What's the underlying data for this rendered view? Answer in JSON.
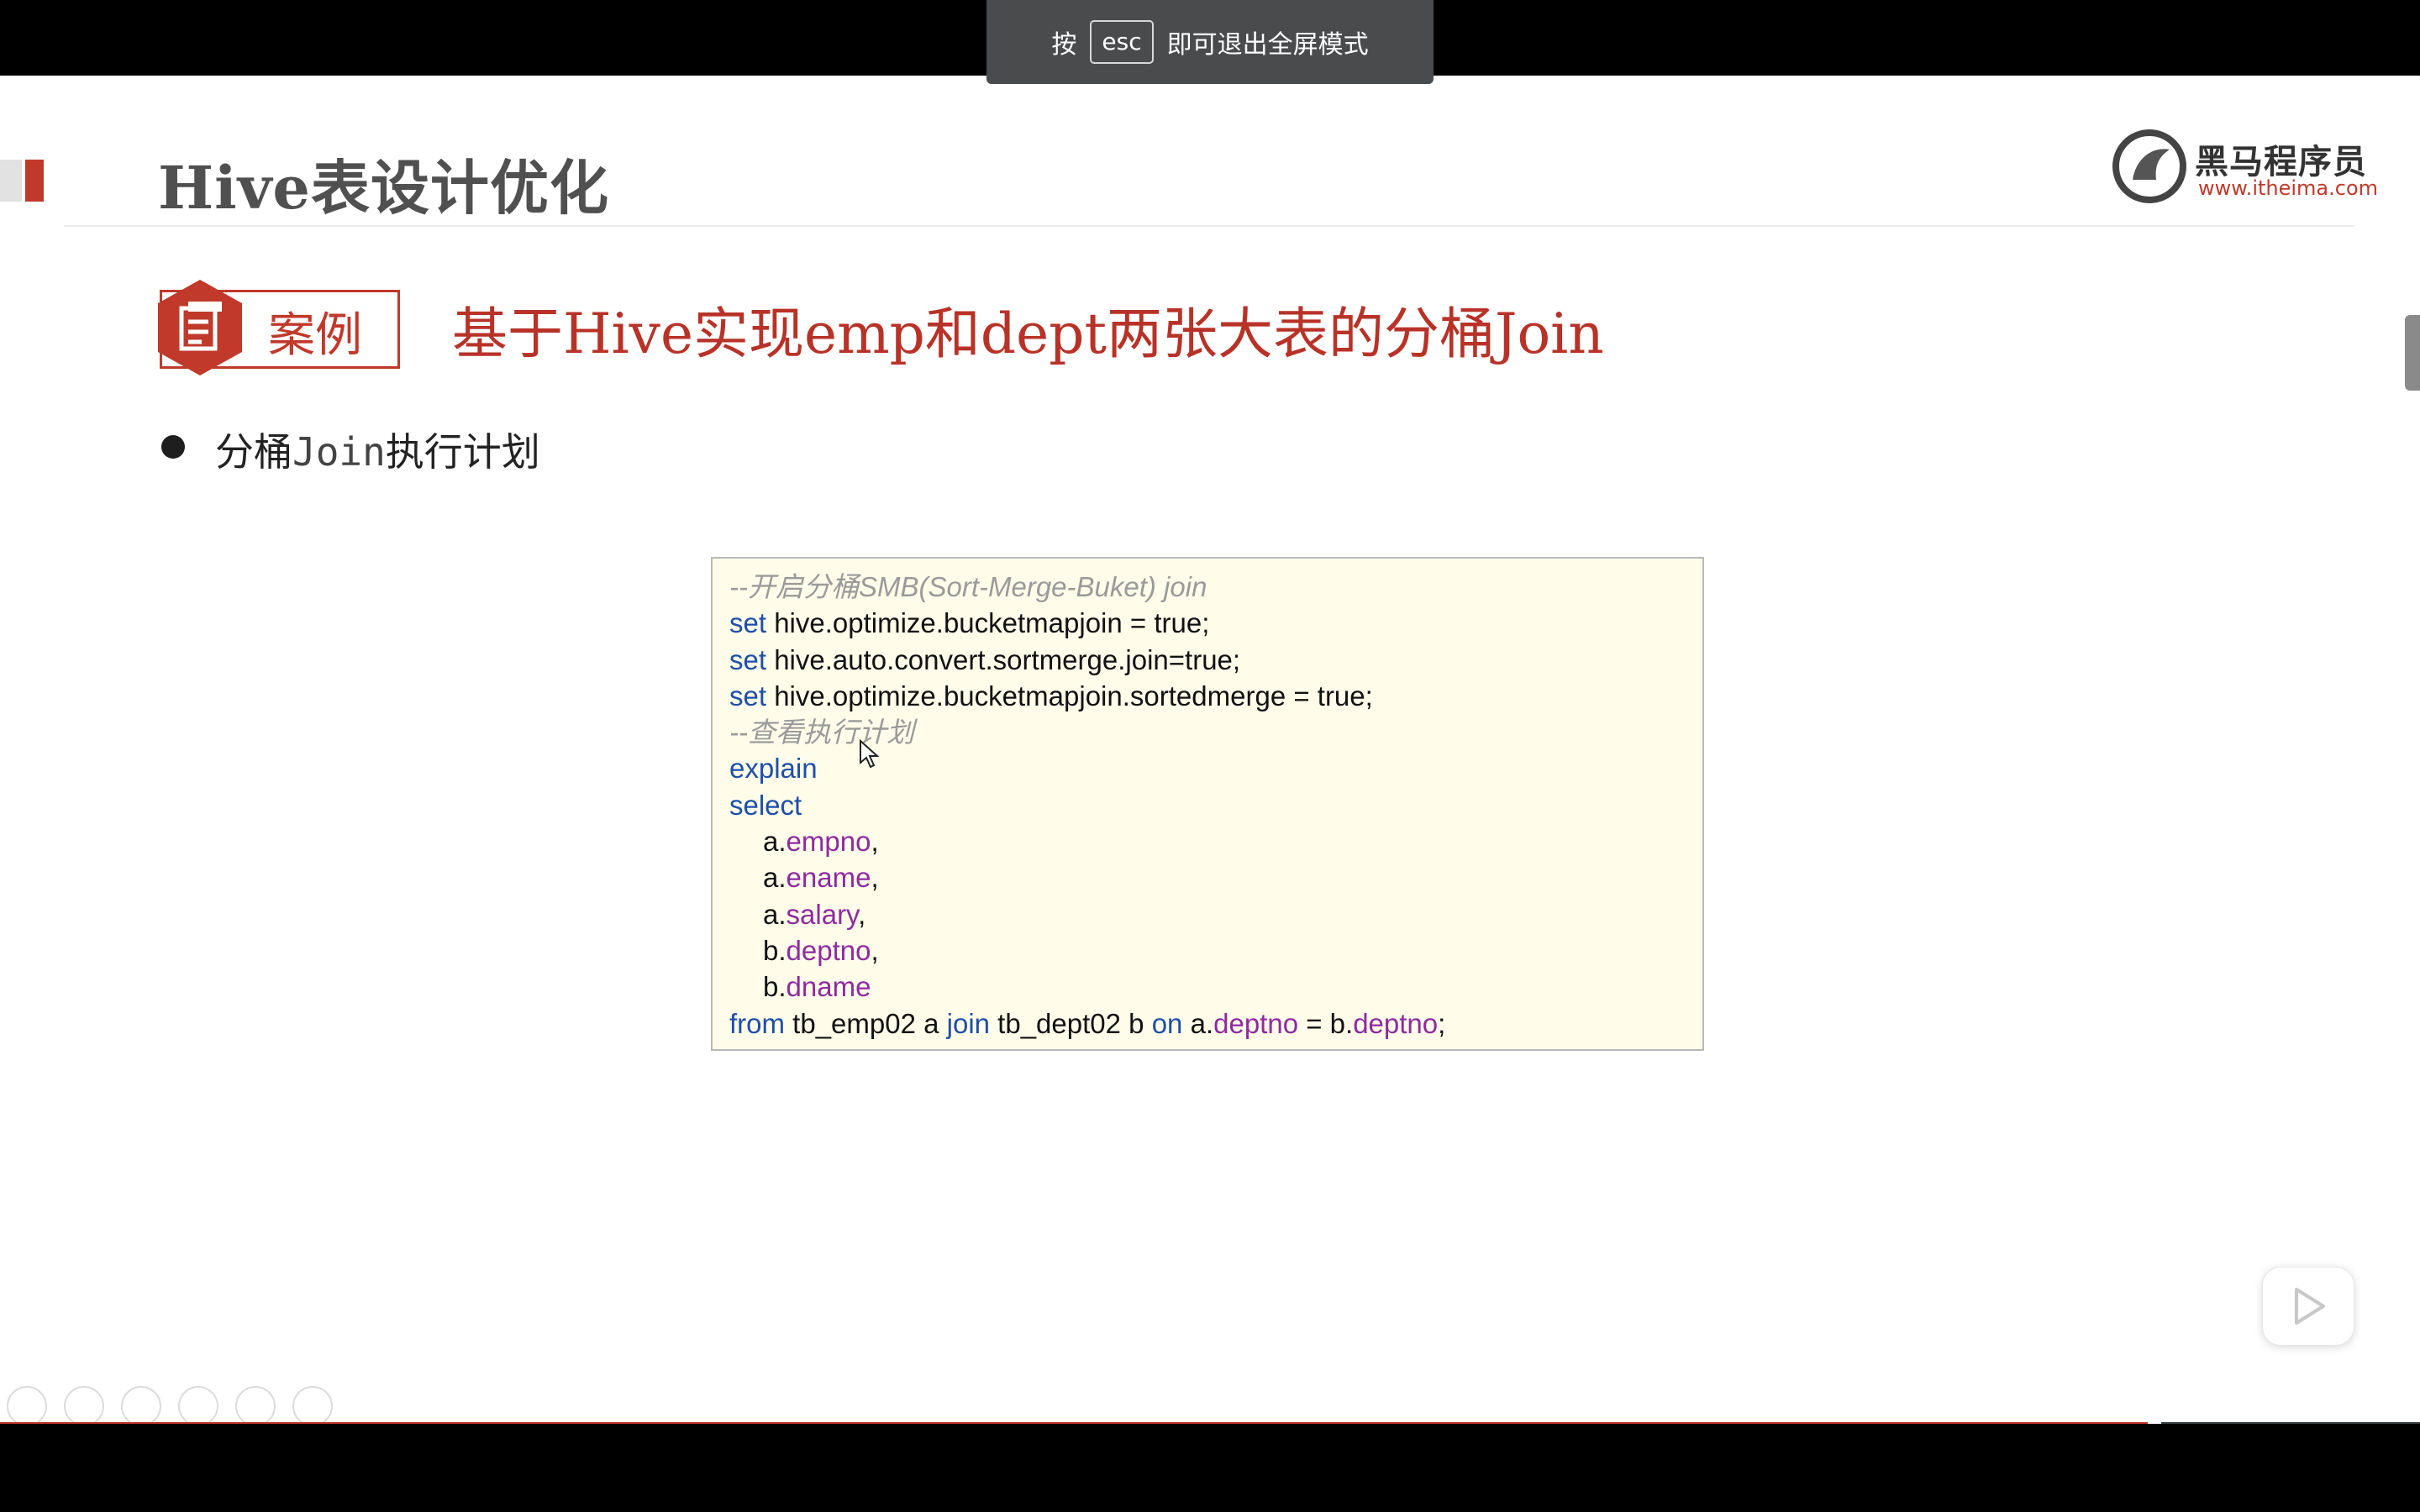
{
  "toast": {
    "prefix": "按",
    "key": "esc",
    "suffix": "即可退出全屏模式"
  },
  "slide": {
    "title": "Hive表设计优化",
    "logo": {
      "name": "黑马程序员",
      "url": "www.itheima.com"
    },
    "case_label": "案例",
    "case_title": "基于Hive实现emp和dept两张大表的分桶Join",
    "bullet": {
      "part1": "分桶",
      "part2": "Join",
      "part3": "执行计划"
    },
    "code": {
      "comment1": "--开启分桶SMB(Sort-Merge-Buket) join",
      "set_kw": "set",
      "line1": " hive.optimize.bucketmapjoin = true;",
      "line2": " hive.auto.convert.sortmerge.join=true;",
      "line3": " hive.optimize.bucketmapjoin.sortedmerge = true;",
      "comment2": "--查看执行计划",
      "explain": "explain",
      "select": "select",
      "fields": [
        {
          "alias": "a.",
          "name": "empno",
          "sep": ","
        },
        {
          "alias": "a.",
          "name": "ename",
          "sep": ","
        },
        {
          "alias": "a.",
          "name": "salary",
          "sep": ","
        },
        {
          "alias": "b.",
          "name": "deptno",
          "sep": ","
        },
        {
          "alias": "b.",
          "name": "dname",
          "sep": ""
        }
      ],
      "from_kw": "from",
      "from_table1": " tb_emp02 a ",
      "join_kw": "join",
      "from_table2": " tb_dept02 b ",
      "on_kw": "on",
      "on_left_alias": " a.",
      "on_left_field": "deptno",
      "on_eq": " = b.",
      "on_right_field": "deptno",
      "on_end": ";"
    }
  },
  "colors": {
    "accent": "#c0392b",
    "keyword": "#1d4fa8",
    "field": "#8e2ba0",
    "comment": "#9a9a9a",
    "code_bg": "#fffcea"
  },
  "icons": [
    "document-icon",
    "play-icon",
    "prev-icon",
    "next-icon",
    "pen-icon",
    "slides-icon",
    "zoom-icon",
    "more-icon",
    "mouse-cursor-icon"
  ]
}
